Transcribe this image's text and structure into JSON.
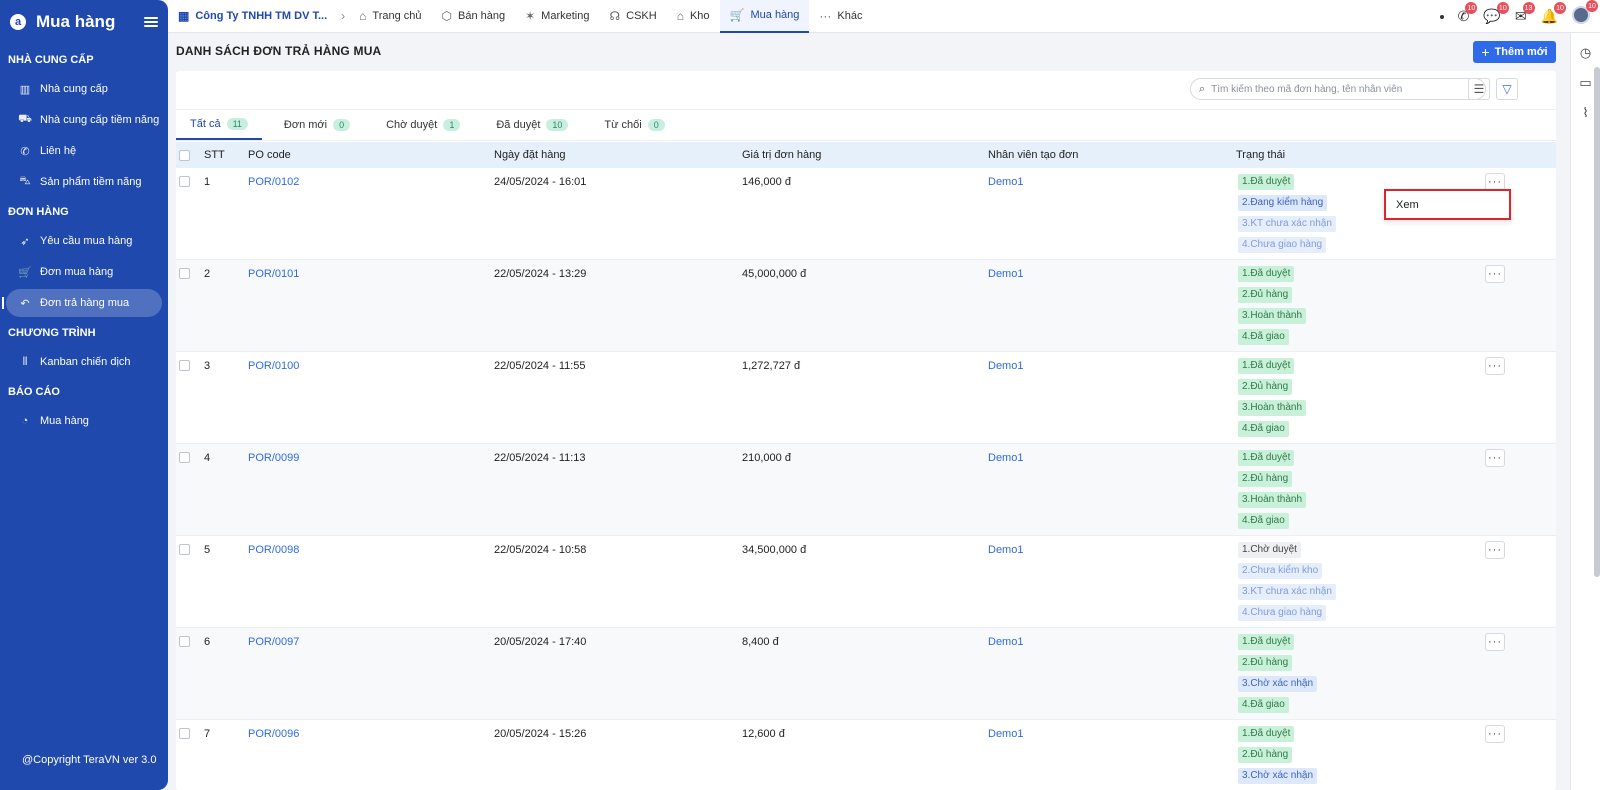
{
  "sidebar": {
    "title": "Mua hàng",
    "logo": "a",
    "sections": [
      {
        "title": "NHÀ CUNG CẤP",
        "items": [
          {
            "label": "Nhà cung cấp",
            "icon": "building-icon"
          },
          {
            "label": "Nhà cung cấp tiềm năng",
            "icon": "truck-icon"
          },
          {
            "label": "Liên hệ",
            "icon": "phone-icon"
          },
          {
            "label": "Sản phẩm tiềm năng",
            "icon": "delivery-icon"
          }
        ]
      },
      {
        "title": "ĐƠN HÀNG",
        "items": [
          {
            "label": "Yêu cầu mua hàng",
            "icon": "rocket-icon"
          },
          {
            "label": "Đơn mua hàng",
            "icon": "cart-icon"
          },
          {
            "label": "Đơn trả hàng mua",
            "icon": "return-icon",
            "active": true
          }
        ]
      },
      {
        "title": "CHƯƠNG TRÌNH",
        "items": [
          {
            "label": "Kanban chiến dịch",
            "icon": "kanban-icon"
          }
        ]
      },
      {
        "title": "BÁO CÁO",
        "items": [
          {
            "label": "Mua hàng",
            "icon": "chart-pie-icon"
          }
        ]
      }
    ],
    "copyright": "@Copyright TeraVN ver 3.0"
  },
  "topnav": {
    "company": "Công Ty TNHH TM DV T...",
    "items": [
      {
        "label": "Trang chủ",
        "icon": "home-icon"
      },
      {
        "label": "Bán hàng",
        "icon": "box-icon"
      },
      {
        "label": "Marketing",
        "icon": "megaphone-icon"
      },
      {
        "label": "CSKH",
        "icon": "headset-icon"
      },
      {
        "label": "Kho",
        "icon": "warehouse-icon"
      },
      {
        "label": "Mua hàng",
        "icon": "cart-icon",
        "active": true
      },
      {
        "label": "Khác",
        "icon": "ellipsis-icon"
      }
    ],
    "badges": {
      "phone": "10",
      "chat": "10",
      "mail": "13",
      "bell": "10",
      "user": "10"
    }
  },
  "page": {
    "title": "DANH SÁCH ĐƠN TRẢ HÀNG MUA",
    "add_label": "Thêm mới",
    "search_placeholder": "Tìm kiếm theo mã đơn hàng, tên nhân viên"
  },
  "tabs": [
    {
      "label": "Tất cả",
      "count": "11",
      "active": true
    },
    {
      "label": "Đơn mới",
      "count": "0"
    },
    {
      "label": "Chờ duyệt",
      "count": "1"
    },
    {
      "label": "Đã duyệt",
      "count": "10"
    },
    {
      "label": "Từ chối",
      "count": "0"
    }
  ],
  "columns": [
    "STT",
    "PO code",
    "Ngày đặt hàng",
    "Giá trị đơn hàng",
    "Nhân viên tạo đơn",
    "Trạng thái"
  ],
  "rows": [
    {
      "stt": "1",
      "po": "POR/0102",
      "date": "24/05/2024 - 16:01",
      "value": "146,000 đ",
      "employee": "Demo1",
      "statuses": [
        [
          "1.Đã duyệt",
          "g"
        ],
        [
          "2.Đang kiểm hàng",
          "b"
        ],
        [
          "3.KT chưa xác nhận",
          "lb"
        ],
        [
          "4.Chưa giao hàng",
          "lb"
        ]
      ]
    },
    {
      "stt": "2",
      "po": "POR/0101",
      "date": "22/05/2024 - 13:29",
      "value": "45,000,000 đ",
      "employee": "Demo1",
      "statuses": [
        [
          "1.Đã duyệt",
          "g"
        ],
        [
          "2.Đủ hàng",
          "g"
        ],
        [
          "3.Hoàn thành",
          "g"
        ],
        [
          "4.Đã giao",
          "g"
        ]
      ]
    },
    {
      "stt": "3",
      "po": "POR/0100",
      "date": "22/05/2024 - 11:55",
      "value": "1,272,727 đ",
      "employee": "Demo1",
      "statuses": [
        [
          "1.Đã duyệt",
          "g"
        ],
        [
          "2.Đủ hàng",
          "g"
        ],
        [
          "3.Hoàn thành",
          "g"
        ],
        [
          "4.Đã giao",
          "g"
        ]
      ]
    },
    {
      "stt": "4",
      "po": "POR/0099",
      "date": "22/05/2024 - 11:13",
      "value": "210,000 đ",
      "employee": "Demo1",
      "statuses": [
        [
          "1.Đã duyệt",
          "g"
        ],
        [
          "2.Đủ hàng",
          "g"
        ],
        [
          "3.Hoàn thành",
          "g"
        ],
        [
          "4.Đã giao",
          "g"
        ]
      ]
    },
    {
      "stt": "5",
      "po": "POR/0098",
      "date": "22/05/2024 - 10:58",
      "value": "34,500,000 đ",
      "employee": "Demo1",
      "statuses": [
        [
          "1.Chờ duyệt",
          "gray"
        ],
        [
          "2.Chưa kiểm kho",
          "lb"
        ],
        [
          "3.KT chưa xác nhận",
          "lb"
        ],
        [
          "4.Chưa giao hàng",
          "lb"
        ]
      ]
    },
    {
      "stt": "6",
      "po": "POR/0097",
      "date": "20/05/2024 - 17:40",
      "value": "8,400 đ",
      "employee": "Demo1",
      "statuses": [
        [
          "1.Đã duyệt",
          "g"
        ],
        [
          "2.Đủ hàng",
          "g"
        ],
        [
          "3.Chờ xác nhận",
          "b"
        ],
        [
          "4.Đã giao",
          "g"
        ]
      ]
    },
    {
      "stt": "7",
      "po": "POR/0096",
      "date": "20/05/2024 - 15:26",
      "value": "12,600 đ",
      "employee": "Demo1",
      "statuses": [
        [
          "1.Đã duyệt",
          "g"
        ],
        [
          "2.Đủ hàng",
          "g"
        ],
        [
          "3.Chờ xác nhận",
          "b"
        ]
      ]
    }
  ],
  "row_menu": {
    "label": "Xem"
  }
}
